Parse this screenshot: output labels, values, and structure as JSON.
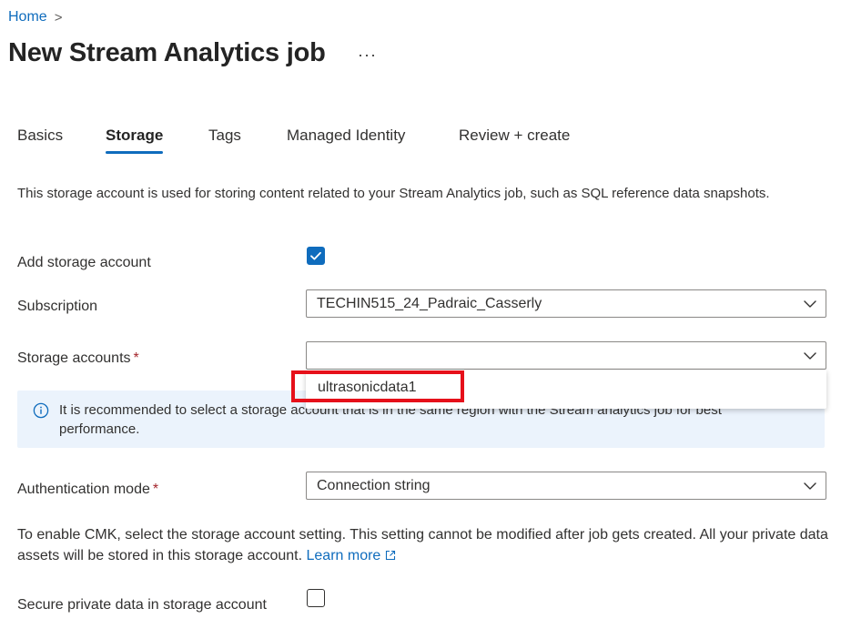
{
  "breadcrumb": {
    "home": "Home",
    "separator": ">"
  },
  "header": {
    "title": "New Stream Analytics job",
    "more": "···"
  },
  "tabs": [
    {
      "label": "Basics",
      "active": false
    },
    {
      "label": "Storage",
      "active": true
    },
    {
      "label": "Tags",
      "active": false
    },
    {
      "label": "Managed Identity",
      "active": false
    },
    {
      "label": "Review + create",
      "active": false
    }
  ],
  "description": "This storage account is used for storing content related to your Stream Analytics job, such as SQL reference data snapshots.",
  "form": {
    "add_storage": {
      "label": "Add storage account",
      "checked": true
    },
    "subscription": {
      "label": "Subscription",
      "value": "TECHIN515_24_Padraic_Casserly"
    },
    "storage_accounts": {
      "label": "Storage accounts",
      "required_mark": "*",
      "value": "",
      "options": [
        "ultrasonicdata1"
      ]
    },
    "info": "It is recommended to select a storage account that is in the same region with the Stream analytics job for best performance.",
    "auth_mode": {
      "label": "Authentication mode",
      "required_mark": "*",
      "value": "Connection string"
    },
    "cmk": {
      "text": "To enable CMK, select the storage account setting. This setting cannot be modified after job gets created. All your private data assets will be stored in this storage account.",
      "link": "Learn more"
    },
    "secure_data": {
      "label": "Secure private data in storage account",
      "checked": false
    }
  },
  "colors": {
    "accent": "#0f6cbd",
    "highlight": "#e6101a",
    "info_bg": "#ebf3fc",
    "required": "#a4262c"
  }
}
